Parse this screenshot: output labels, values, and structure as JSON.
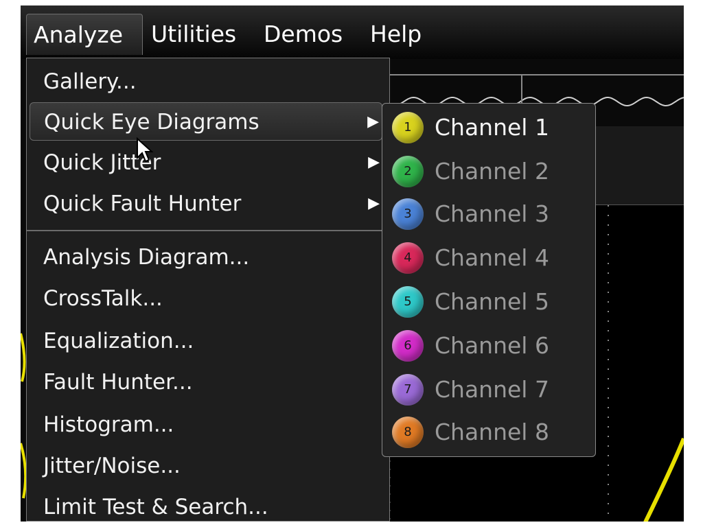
{
  "menubar": {
    "items": [
      {
        "label": "Analyze"
      },
      {
        "label": "Utilities"
      },
      {
        "label": "Demos"
      },
      {
        "label": "Help"
      }
    ]
  },
  "analyze_menu": {
    "items": [
      {
        "label": "Gallery..."
      },
      {
        "label": "Quick Eye Diagrams",
        "has_submenu": true,
        "highlighted": true
      },
      {
        "label": "Quick Jitter",
        "has_submenu": true
      },
      {
        "label": "Quick Fault Hunter",
        "has_submenu": true
      },
      {
        "label": "Analysis Diagram..."
      },
      {
        "label": "CrossTalk..."
      },
      {
        "label": "Equalization..."
      },
      {
        "label": "Fault Hunter..."
      },
      {
        "label": "Histogram..."
      },
      {
        "label": "Jitter/Noise..."
      },
      {
        "label": "Limit Test & Search..."
      }
    ]
  },
  "channel_submenu": {
    "items": [
      {
        "number": "1",
        "label": "Channel 1",
        "color": "#d8d21e",
        "active": true
      },
      {
        "number": "2",
        "label": "Channel 2",
        "color": "#2fb34a"
      },
      {
        "number": "3",
        "label": "Channel 3",
        "color": "#4a82d6"
      },
      {
        "number": "4",
        "label": "Channel 4",
        "color": "#d8285a"
      },
      {
        "number": "5",
        "label": "Channel 5",
        "color": "#2ec8c8"
      },
      {
        "number": "6",
        "label": "Channel 6",
        "color": "#d22cc8"
      },
      {
        "number": "7",
        "label": "Channel 7",
        "color": "#9a6ad6"
      },
      {
        "number": "8",
        "label": "Channel 8",
        "color": "#e07a24"
      }
    ]
  },
  "colors": {
    "trace": "#e8e000",
    "waveform": "#d0d0d0"
  }
}
